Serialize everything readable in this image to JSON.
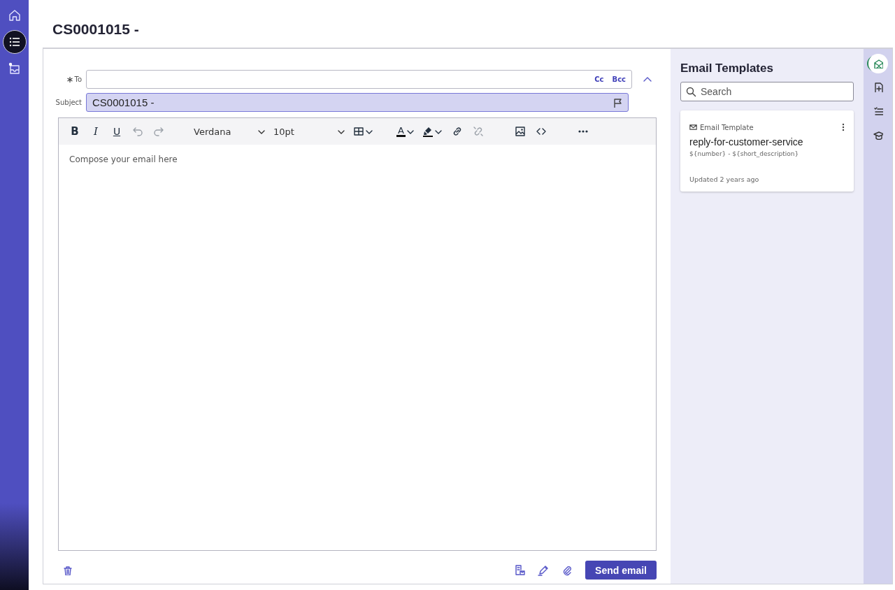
{
  "nav": {
    "items": [
      {
        "kind": "home",
        "selected": false
      },
      {
        "kind": "list",
        "selected": true
      },
      {
        "kind": "inbox",
        "selected": false
      }
    ]
  },
  "title": "CS0001015 -",
  "compose": {
    "to": {
      "label": "To",
      "required": true,
      "cc": "Cc",
      "bcc": "Bcc"
    },
    "subject": {
      "label": "Subject",
      "value": "CS0001015 -"
    },
    "toolbar": [
      {
        "kind": "bold",
        "label": "B",
        "disabled": false
      },
      {
        "kind": "italic",
        "label": "I",
        "disabled": false
      },
      {
        "kind": "underline",
        "label": "U",
        "disabled": false
      },
      {
        "kind": "undo",
        "disabled": true
      },
      {
        "kind": "redo",
        "disabled": true
      },
      {
        "kind": "font",
        "value": "Verdana",
        "disabled": false
      },
      {
        "kind": "size",
        "value": "10pt",
        "disabled": false
      },
      {
        "kind": "table",
        "disabled": false
      },
      {
        "kind": "textcolor",
        "label": "A",
        "disabled": false
      },
      {
        "kind": "highlight",
        "disabled": false
      },
      {
        "kind": "link",
        "disabled": false
      },
      {
        "kind": "unlink",
        "disabled": true
      },
      {
        "kind": "image",
        "disabled": false
      },
      {
        "kind": "code",
        "disabled": false
      },
      {
        "kind": "more",
        "disabled": false
      }
    ],
    "editor": {
      "placeholder": "Compose your email here"
    },
    "send_button": "Send email"
  },
  "templates": {
    "title": "Email Templates",
    "search": {
      "placeholder": "Search"
    },
    "cards": [
      {
        "type": "Email Template",
        "name": "reply-for-customer-service",
        "subject": "${number} - ${short_description}",
        "updated": "Updated 2 years ago"
      }
    ]
  },
  "rail": {
    "items": [
      {
        "kind": "email",
        "selected": true
      },
      {
        "kind": "add-doc",
        "selected": false
      },
      {
        "kind": "list",
        "selected": false
      },
      {
        "kind": "cap",
        "selected": false
      }
    ]
  }
}
